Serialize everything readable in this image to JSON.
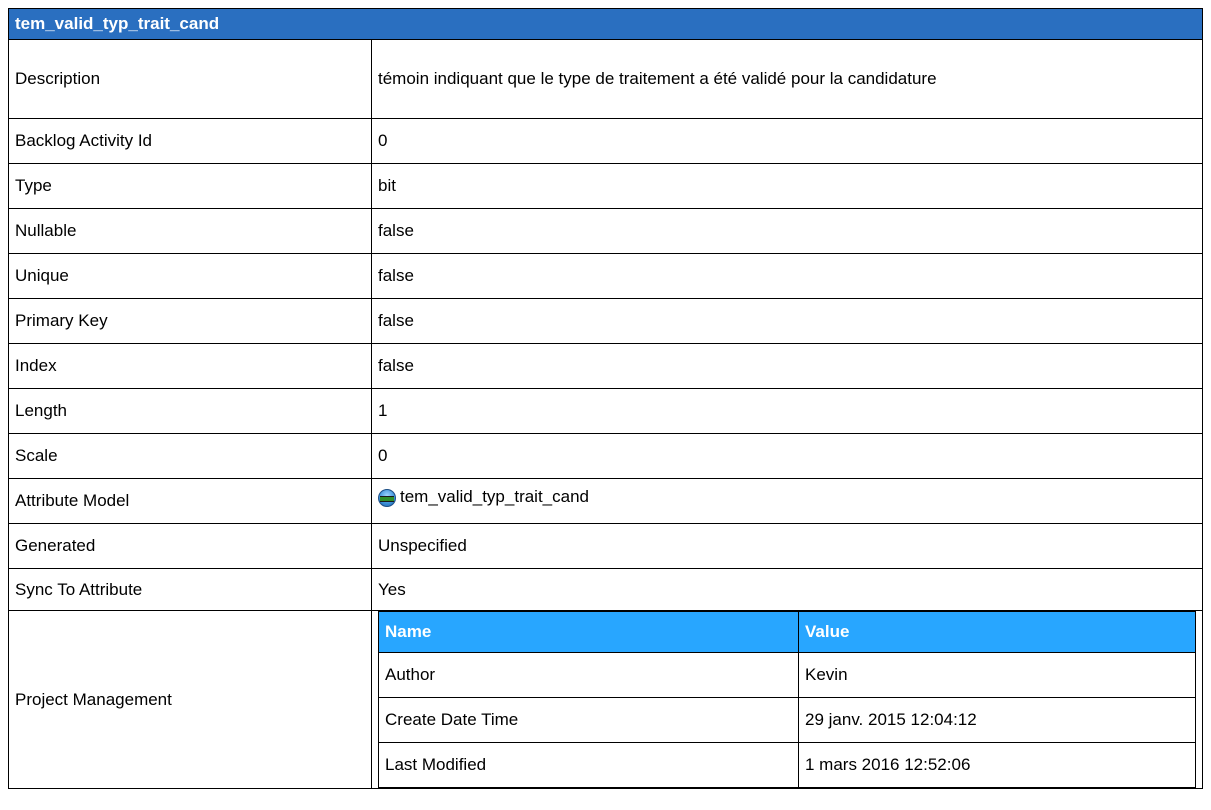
{
  "header": {
    "title": "tem_valid_typ_trait_cand"
  },
  "properties": [
    {
      "label": "Description",
      "value": "témoin indiquant que le type de traitement a été validé pour la candidature"
    },
    {
      "label": "Backlog Activity Id",
      "value": "0"
    },
    {
      "label": "Type",
      "value": "bit"
    },
    {
      "label": "Nullable",
      "value": "false"
    },
    {
      "label": "Unique",
      "value": "false"
    },
    {
      "label": "Primary Key",
      "value": "false"
    },
    {
      "label": "Index",
      "value": "false"
    },
    {
      "label": "Length",
      "value": "1"
    },
    {
      "label": "Scale",
      "value": "0"
    },
    {
      "label": "Attribute Model",
      "value": "tem_valid_typ_trait_cand",
      "icon": "attribute-icon"
    },
    {
      "label": "Generated",
      "value": "Unspecified"
    },
    {
      "label": "Sync To Attribute",
      "value": "Yes"
    }
  ],
  "project_management": {
    "label": "Project Management",
    "columns": [
      "Name",
      "Value"
    ],
    "rows": [
      [
        "Author",
        "Kevin"
      ],
      [
        "Create Date Time",
        "29 janv. 2015 12:04:12"
      ],
      [
        "Last Modified",
        "1 mars 2016 12:52:06"
      ]
    ]
  },
  "colors": {
    "title_bar": "#2a6fc0",
    "subheader": "#28a6ff"
  }
}
